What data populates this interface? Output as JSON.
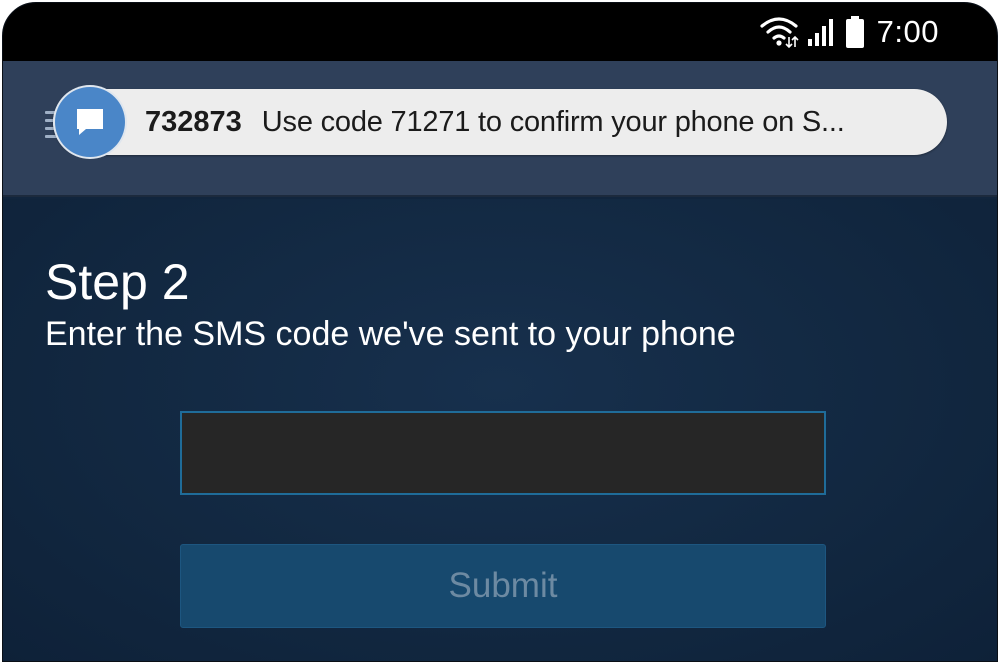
{
  "status_bar": {
    "time": "7:00",
    "icons": [
      "wifi-icon",
      "signal-icon",
      "battery-icon"
    ]
  },
  "notification": {
    "icon": "message-icon",
    "sender": "732873",
    "message": "Use code 71271 to confirm your phone on S..."
  },
  "step": {
    "title": "Step 2",
    "subtitle": "Enter the SMS code we've sent to your phone"
  },
  "form": {
    "code_value": "",
    "code_placeholder": "",
    "submit_label": "Submit"
  },
  "colors": {
    "background": "#11253d",
    "notification_bar": "#2f405a",
    "avatar_blue": "#4a86c8",
    "input_border": "#1f6c99",
    "submit_bg": "#17496e",
    "submit_text": "#6d8aa2"
  }
}
